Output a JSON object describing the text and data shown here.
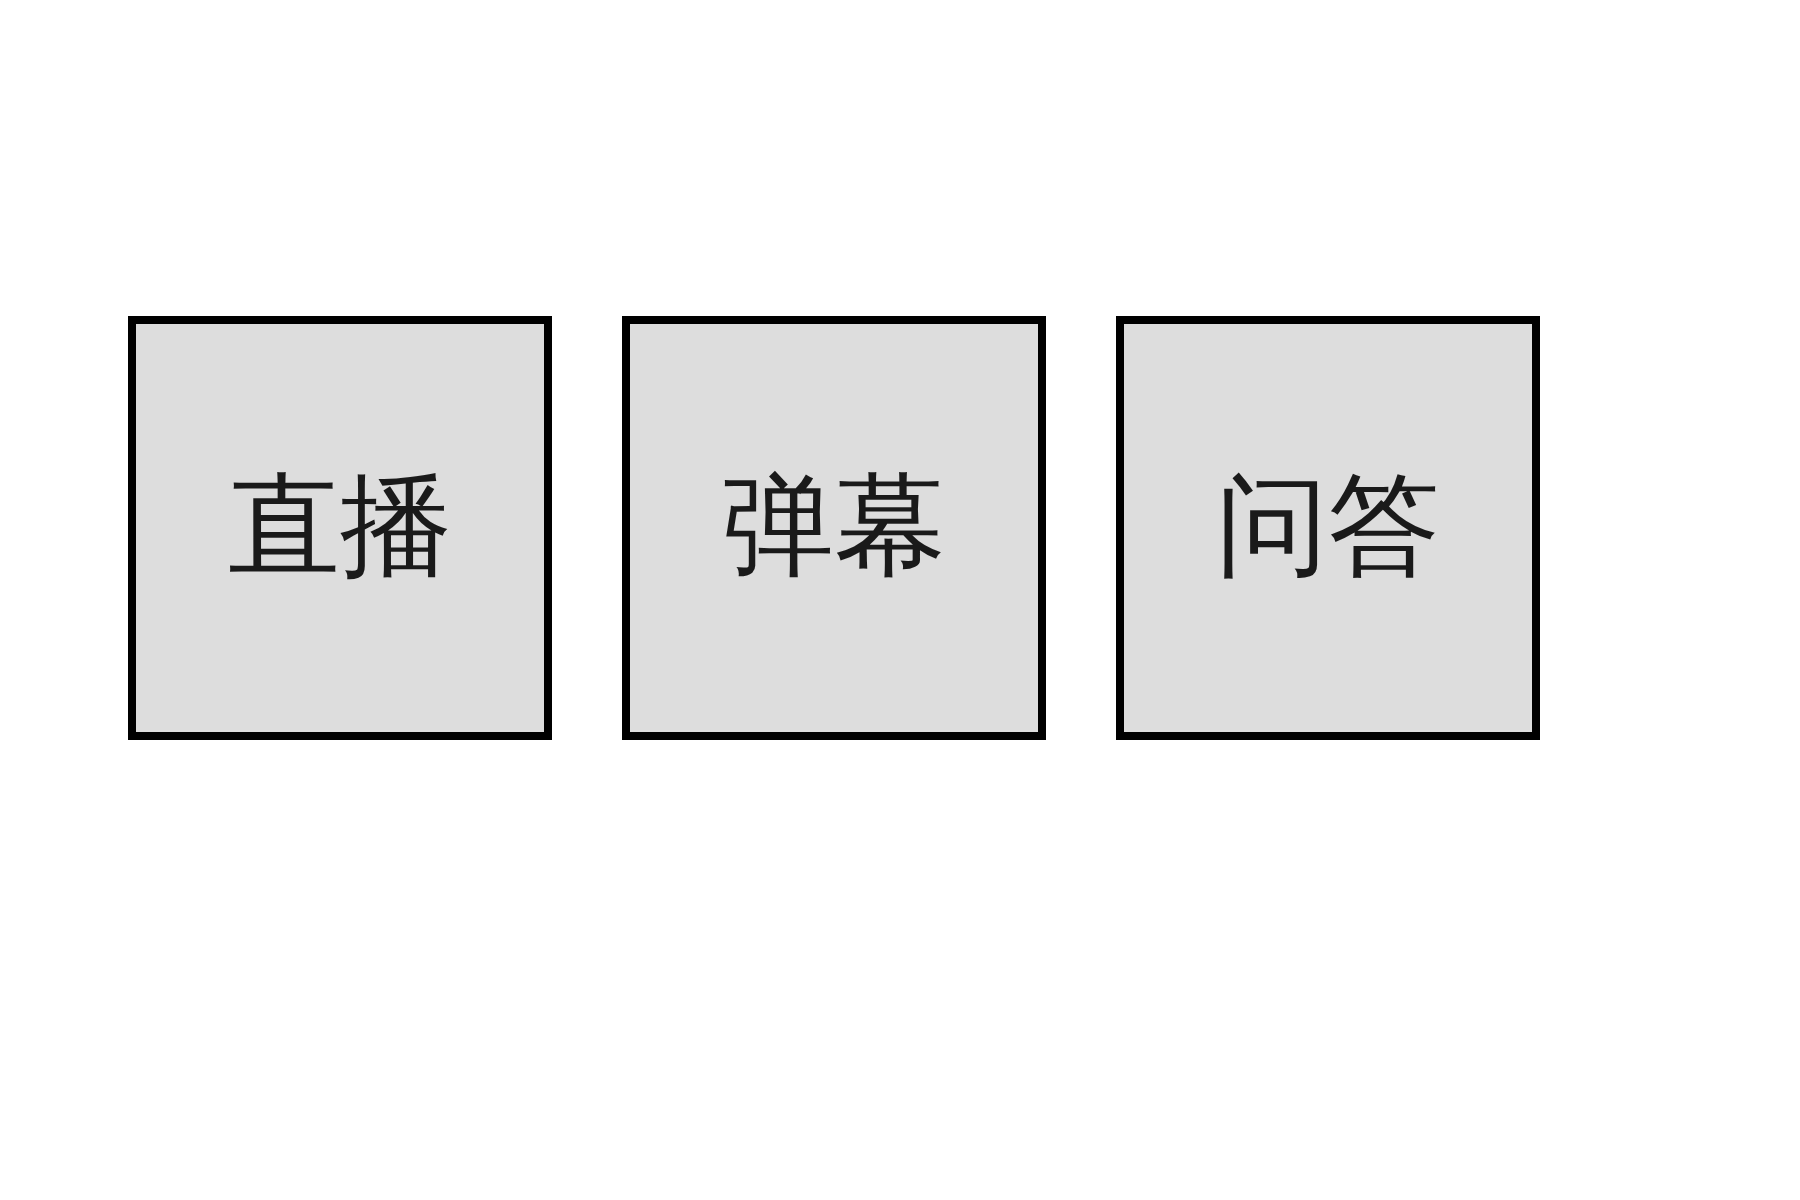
{
  "buttons": [
    {
      "label": "直播"
    },
    {
      "label": "弹幕"
    },
    {
      "label": "问答"
    }
  ]
}
